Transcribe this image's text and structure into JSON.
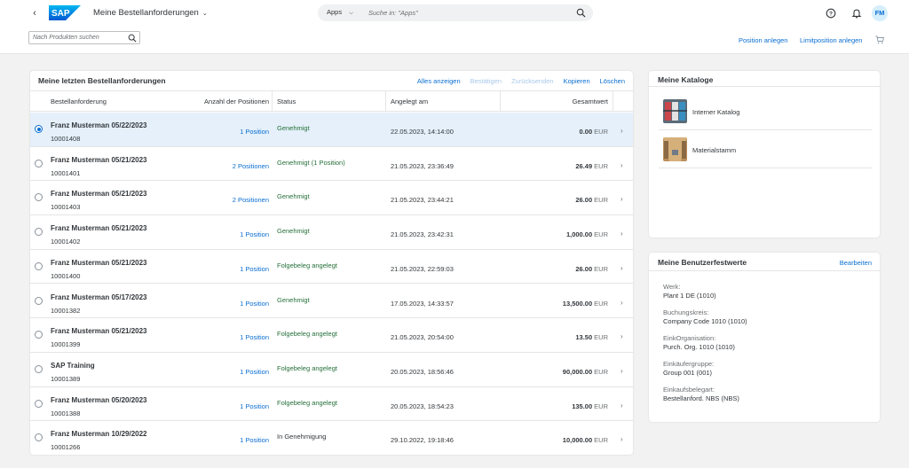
{
  "shell": {
    "logo_text": "SAP",
    "app_title": "Meine Bestellanforderungen",
    "search_scope": "Apps",
    "search_placeholder": "Suche in: \"Apps\"",
    "avatar_initials": "FM",
    "brand_color": "#0a6ed1"
  },
  "subbar": {
    "product_search_placeholder": "Nach Produkten suchen",
    "create_item": "Position anlegen",
    "create_limit_item": "Limitposition anlegen"
  },
  "requests": {
    "title": "Meine letzten Bestellanforderungen",
    "actions": {
      "show_all": "Alles anzeigen",
      "confirm": "Bestätigen",
      "reset": "Zurücksenden",
      "copy": "Kopieren",
      "delete": "Löschen"
    },
    "columns": {
      "request": "Bestellanforderung",
      "positions": "Anzahl der Positionen",
      "status": "Status",
      "created": "Angelegt am",
      "total": "Gesamtwert"
    },
    "rows": [
      {
        "name": "Franz Musterman 05/22/2023",
        "id": "10001408",
        "positions": "1 Position",
        "status": "Genehmigt",
        "created": "22.05.2023, 14:14:00",
        "total": "0.00",
        "currency": "EUR",
        "selected": true
      },
      {
        "name": "Franz Musterman 05/21/2023",
        "id": "10001401",
        "positions": "2 Positionen",
        "status": "Genehmigt (1 Position)",
        "created": "21.05.2023, 23:36:49",
        "total": "26.49",
        "currency": "EUR",
        "selected": false
      },
      {
        "name": "Franz Musterman 05/21/2023",
        "id": "10001403",
        "positions": "2 Positionen",
        "status": "Genehmigt",
        "created": "21.05.2023, 23:44:21",
        "total": "26.00",
        "currency": "EUR",
        "selected": false
      },
      {
        "name": "Franz Musterman 05/21/2023",
        "id": "10001402",
        "positions": "1 Position",
        "status": "Genehmigt",
        "created": "21.05.2023, 23:42:31",
        "total": "1,000.00",
        "currency": "EUR",
        "selected": false
      },
      {
        "name": "Franz Musterman 05/21/2023",
        "id": "10001400",
        "positions": "1 Position",
        "status": "Folgebeleg angelegt",
        "created": "21.05.2023, 22:59:03",
        "total": "26.00",
        "currency": "EUR",
        "selected": false
      },
      {
        "name": "Franz Musterman 05/17/2023",
        "id": "10001382",
        "positions": "1 Position",
        "status": "Genehmigt",
        "created": "17.05.2023, 14:33:57",
        "total": "13,500.00",
        "currency": "EUR",
        "selected": false
      },
      {
        "name": "Franz Musterman 05/21/2023",
        "id": "10001399",
        "positions": "1 Position",
        "status": "Folgebeleg angelegt",
        "created": "21.05.2023, 20:54:00",
        "total": "13.50",
        "currency": "EUR",
        "selected": false
      },
      {
        "name": "SAP Training",
        "id": "10001389",
        "positions": "1 Position",
        "status": "Folgebeleg angelegt",
        "created": "20.05.2023, 18:56:46",
        "total": "90,000.00",
        "currency": "EUR",
        "selected": false
      },
      {
        "name": "Franz Musterman 05/20/2023",
        "id": "10001388",
        "positions": "1 Position",
        "status": "Folgebeleg angelegt",
        "created": "20.05.2023, 18:54:23",
        "total": "135.00",
        "currency": "EUR",
        "selected": false
      },
      {
        "name": "Franz Musterman 10/29/2022",
        "id": "10001266",
        "positions": "1 Position",
        "status": "In Genehmigung",
        "created": "29.10.2022, 19:18:46",
        "total": "10,000.00",
        "currency": "EUR",
        "selected": false
      }
    ],
    "status_colors": {
      "approved": "#256f3a",
      "pending": "#32363a"
    }
  },
  "catalogs": {
    "title": "Meine Kataloge",
    "items": [
      {
        "label": "Interner Katalog",
        "icon": "catalog-shelf-image"
      },
      {
        "label": "Materialstamm",
        "icon": "warehouse-image"
      }
    ]
  },
  "defaults": {
    "title": "Meine Benutzerfestwerte",
    "edit": "Bearbeiten",
    "fields": [
      {
        "label": "Werk:",
        "value": "Plant 1 DE (1010)"
      },
      {
        "label": "Buchungskreis:",
        "value": "Company Code 1010 (1010)"
      },
      {
        "label": "EinkOrganisation:",
        "value": "Purch. Org. 1010 (1010)"
      },
      {
        "label": "Einkäufergruppe:",
        "value": "Group 001 (001)"
      },
      {
        "label": "Einkaufsbelegart:",
        "value": "Bestellanford. NBS (NBS)"
      }
    ]
  }
}
